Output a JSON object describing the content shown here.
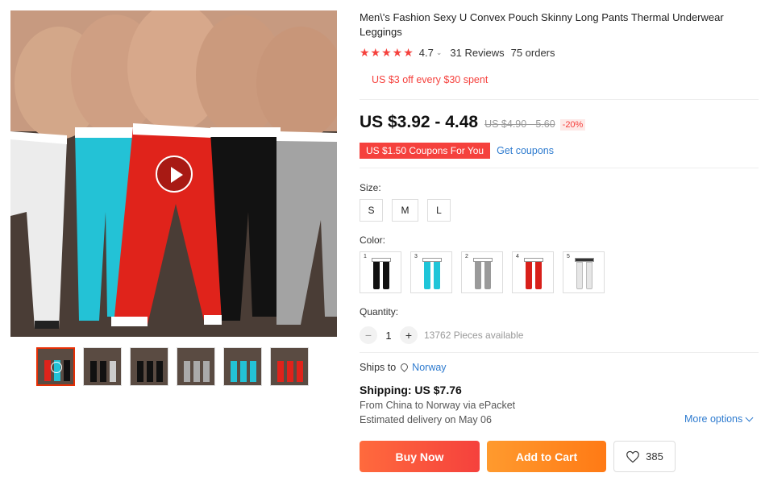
{
  "product": {
    "title": "Men\\'s Fashion Sexy U Convex Pouch Skinny Long Pants Thermal Underwear Leggings",
    "rating": "4.7",
    "stars": "★★★★★",
    "reviews": "31 Reviews",
    "orders": "75 orders",
    "promo": "US $3 off every $30 spent",
    "price": "US $3.92 - 4.48",
    "old_price": "US $4.90 - 5.60",
    "discount": "-20%",
    "coupon_tag": "US $1.50 Coupons For You",
    "get_coupons": "Get coupons"
  },
  "size": {
    "label": "Size:",
    "options": [
      "S",
      "M",
      "L"
    ]
  },
  "color": {
    "label": "Color:",
    "options": [
      {
        "num": "1",
        "color": "#111111"
      },
      {
        "num": "3",
        "color": "#1fc5d8"
      },
      {
        "num": "2",
        "color": "#9a9a9a"
      },
      {
        "num": "4",
        "color": "#d8201a"
      },
      {
        "num": "5",
        "color": "#e6e6e6"
      }
    ]
  },
  "quantity": {
    "label": "Quantity:",
    "minus": "−",
    "value": "1",
    "plus": "+",
    "available": "13762 Pieces available"
  },
  "shipping": {
    "ships_to_label": "Ships to",
    "country": "Norway",
    "cost": "Shipping: US $7.76",
    "route": "From China to Norway via ePacket",
    "delivery": "Estimated delivery on May 06",
    "more_options": "More options"
  },
  "actions": {
    "buy_now": "Buy Now",
    "add_to_cart": "Add to Cart",
    "wishlist_count": "385"
  },
  "colors": {
    "accent": "#f5413d",
    "link": "#2e7bcf",
    "cart": "#ff8a20"
  }
}
